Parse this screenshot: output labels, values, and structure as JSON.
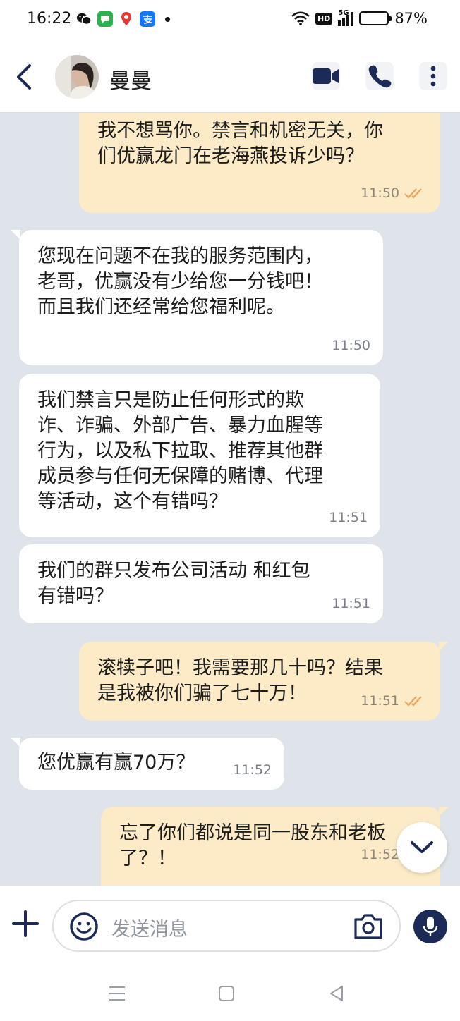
{
  "status_bar": {
    "time": "16:22",
    "network": "5G",
    "hd_badge": "HD",
    "battery_percent_text": "87%",
    "battery_level": 0.87,
    "app_icons": [
      "wechat-icon",
      "messages-icon",
      "maps-pin-icon",
      "alipay-icon"
    ]
  },
  "header": {
    "contact_name": "曼曼",
    "icons": [
      "back-arrow-icon",
      "video-call-icon",
      "phone-call-icon",
      "more-vertical-icon"
    ]
  },
  "messages": [
    {
      "direction": "out",
      "text": "我不想骂你。禁言和机密无关，你\n们优赢龙门在老海燕投诉少吗？",
      "time": "11:50",
      "read": true
    },
    {
      "direction": "in",
      "text": "您现在问题不在我的服务范围内，\n老哥，优赢没有少给您一分钱吧！\n而且我们还经常给您福利呢。",
      "time": "11:50"
    },
    {
      "direction": "in",
      "text": "我们禁言只是防止任何形式的欺\n诈、诈骗、外部广告、暴力血腥等\n行为，以及私下拉取、推荐其他群\n成员参与任何无保障的赌博、代理\n等活动，这个有错吗？",
      "time": "11:51"
    },
    {
      "direction": "in",
      "text": "我们的群只发布公司活动 和红包\n有错吗？",
      "time": "11:51"
    },
    {
      "direction": "out",
      "text": "滚犊子吧！我需要那几十吗？结果\n是我被你们骗了七十万！",
      "time": "11:51",
      "read": true
    },
    {
      "direction": "in",
      "text": "您优赢有赢70万？",
      "time": "11:52"
    },
    {
      "direction": "out",
      "text": "忘了你们都说是同一股东和老板\n了？！",
      "time": "11:52",
      "read": true
    }
  ],
  "composer": {
    "placeholder": "发送消息"
  },
  "colors": {
    "chat_background": "#dfe3ea",
    "outgoing_bubble": "#fcebc6",
    "incoming_bubble": "#ffffff",
    "accent_navy": "#1c2a57",
    "read_check": "#f0a458"
  }
}
